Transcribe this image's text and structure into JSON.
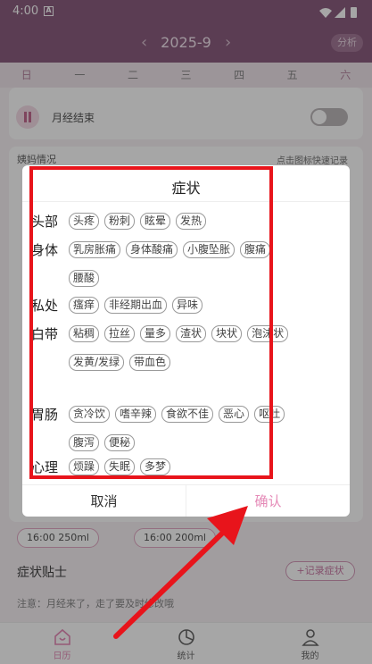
{
  "status_bar": {
    "time": "4:00",
    "notif_letter": "A"
  },
  "header": {
    "title": "2025-9",
    "prev": "‹",
    "next": "›",
    "analyze_label": "分析"
  },
  "weekdays": [
    "日",
    "一",
    "二",
    "三",
    "四",
    "五",
    "六"
  ],
  "background": {
    "period_end_label": "月经结束",
    "aunt_status_label": "姨妈情况",
    "quick_record_hint": "点击图标快速记录",
    "water_entries": [
      "16:00 250ml",
      "16:00 200ml"
    ],
    "symptom_sticker_label": "症状贴士",
    "record_symptom_button": "+记录症状",
    "note": "注意：月经来了，走了要及时修改哦"
  },
  "dialog": {
    "title": "症状",
    "categories": [
      {
        "label": "头部",
        "items": [
          "头疼",
          "粉刺",
          "眩晕",
          "发热"
        ]
      },
      {
        "label": "身体",
        "items": [
          "乳房胀痛",
          "身体酸痛",
          "小腹坠胀",
          "腹痛",
          "腰酸"
        ]
      },
      {
        "label": "私处",
        "items": [
          "瘙痒",
          "非经期出血",
          "异味"
        ]
      },
      {
        "label": "白带",
        "items": [
          "粘稠",
          "拉丝",
          "量多",
          "渣状",
          "块状",
          "泡沫状",
          "发黄/发绿",
          "带血色"
        ]
      },
      {
        "label": "胃肠",
        "items": [
          "贪冷饮",
          "嗜辛辣",
          "食欲不佳",
          "恶心",
          "呕吐",
          "腹泻",
          "便秘"
        ]
      },
      {
        "label": "心理",
        "items": [
          "烦躁",
          "失眠",
          "多梦"
        ]
      }
    ],
    "cancel_label": "取消",
    "confirm_label": "确认"
  },
  "tabbar": {
    "items": [
      "日历",
      "统计",
      "我的"
    ]
  },
  "colors": {
    "header": "#8d5e80",
    "accent": "#e58ab7",
    "annotation": "#e8141b"
  }
}
